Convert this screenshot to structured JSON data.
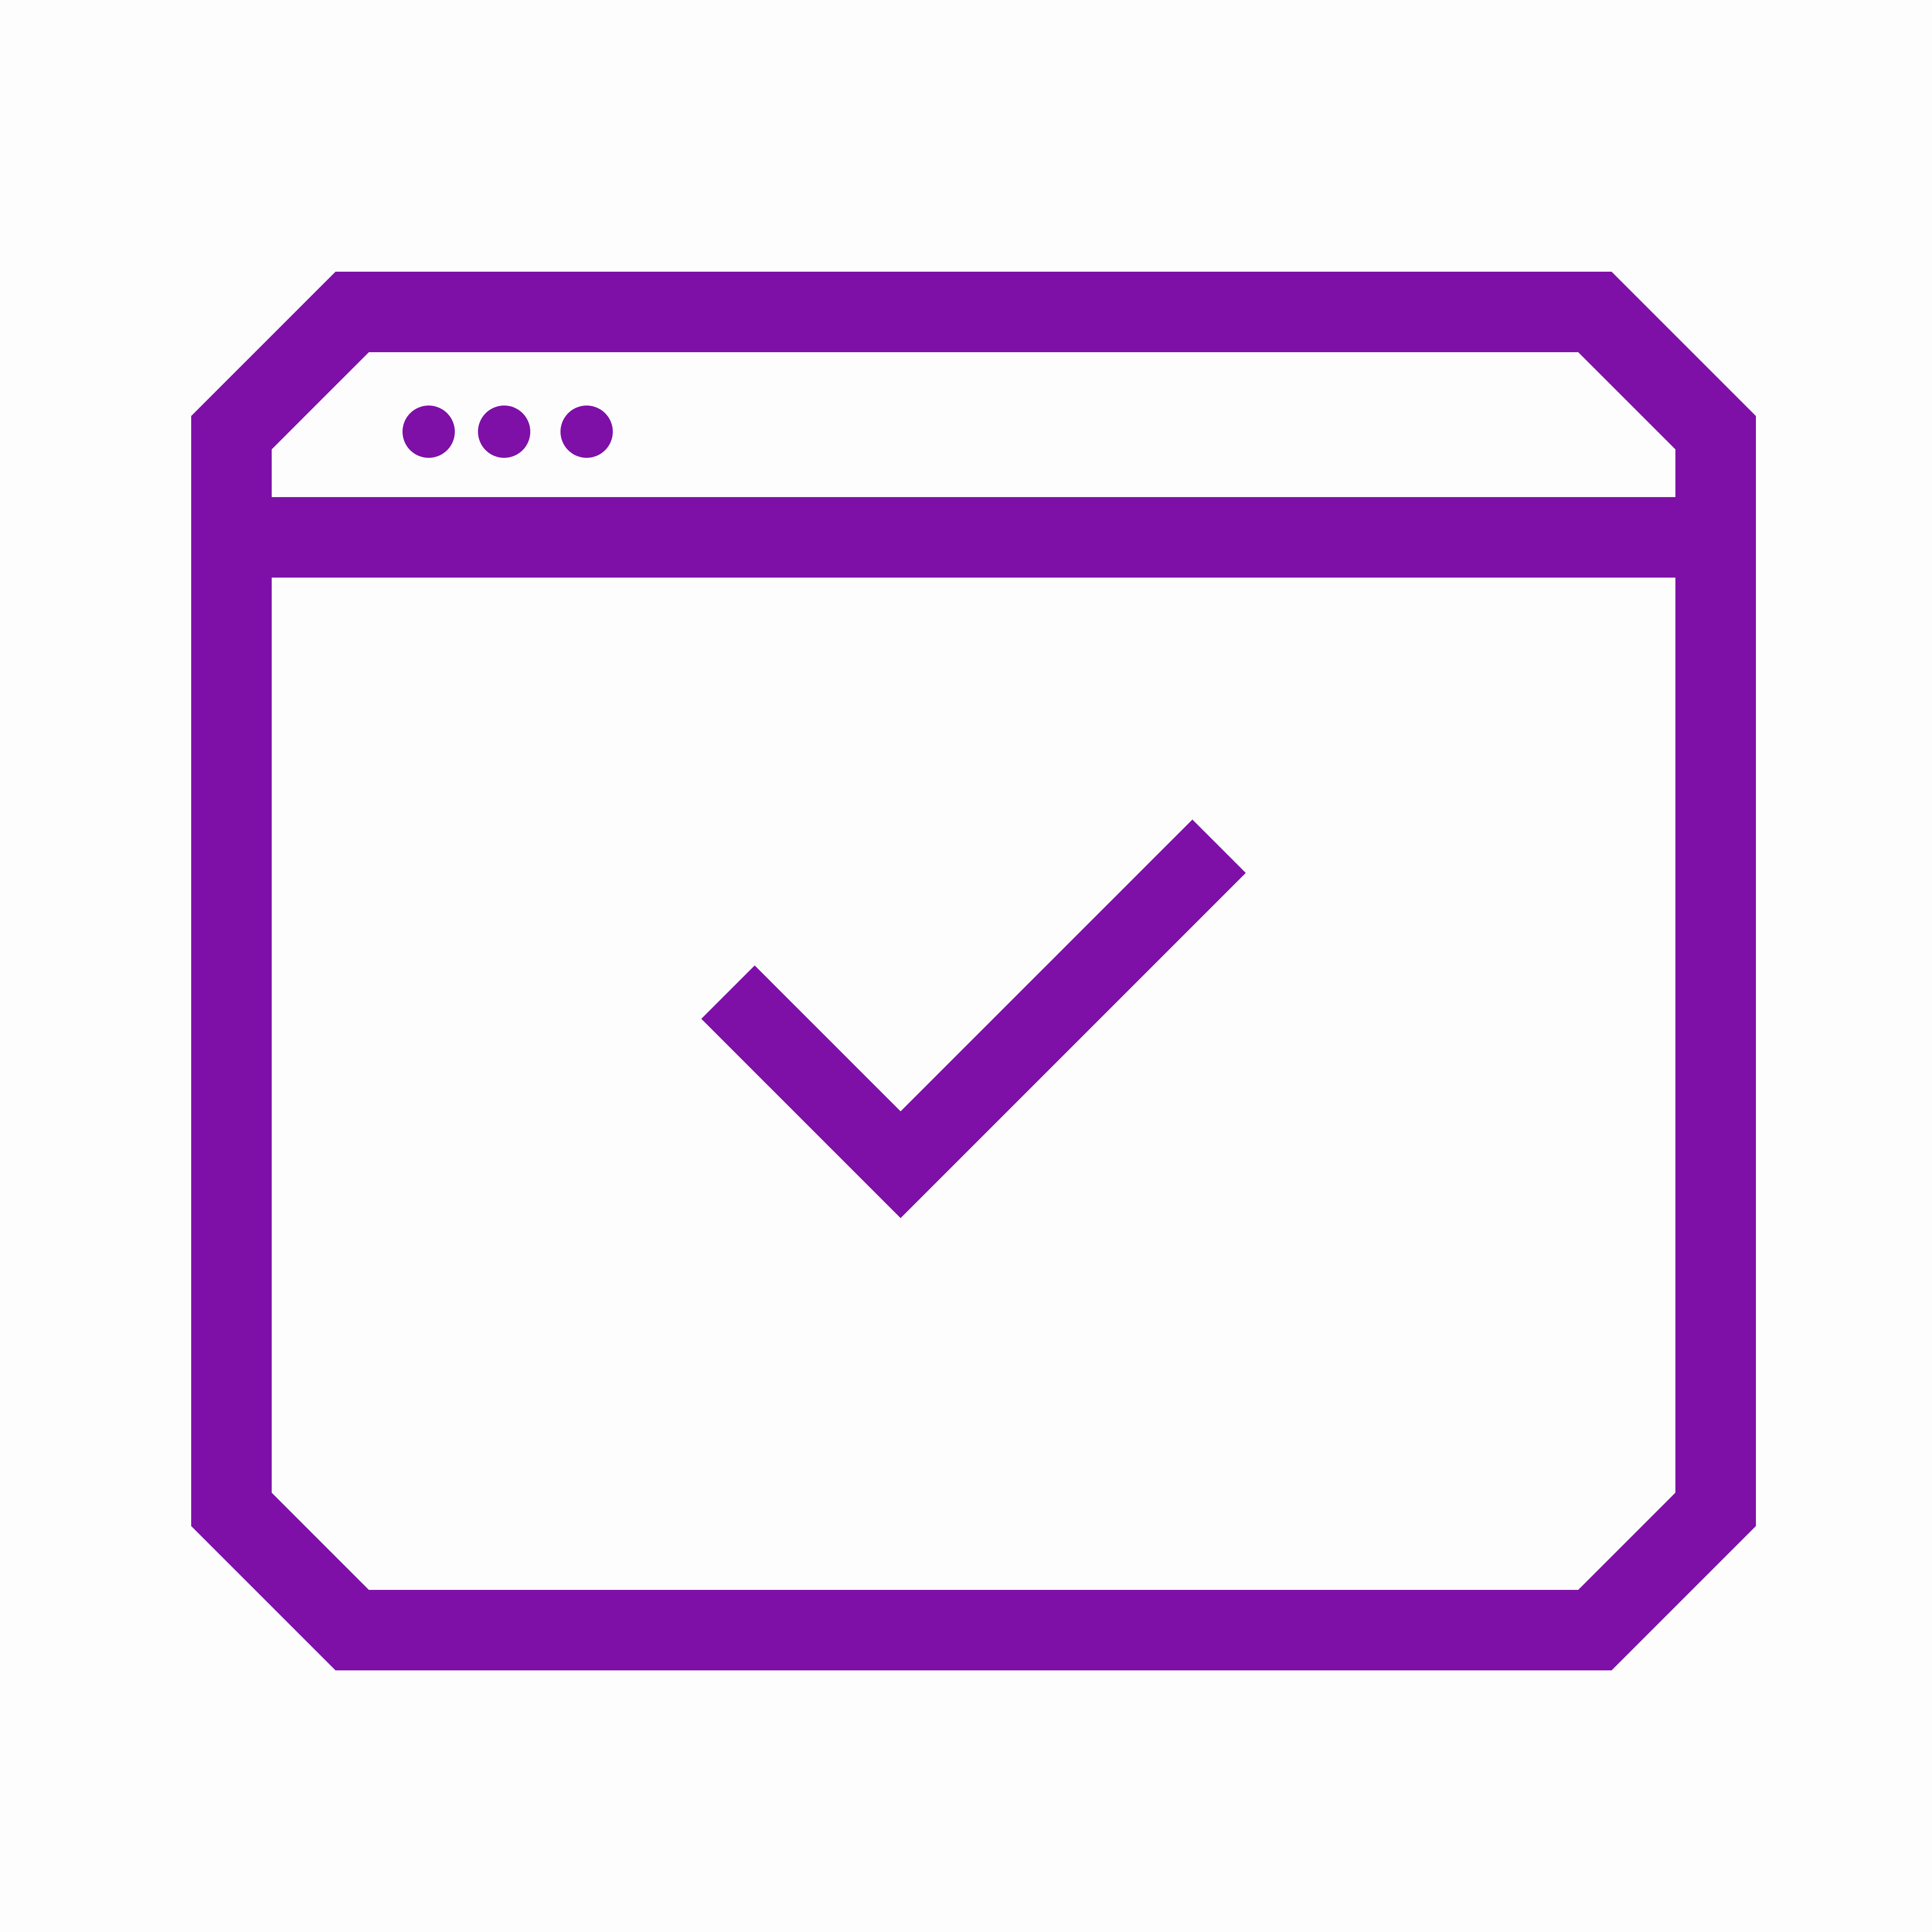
{
  "icon": {
    "name": "browser-window-check-icon",
    "color": "#7e10a8",
    "background": "#fefdfe",
    "window_control_dots": 3
  }
}
